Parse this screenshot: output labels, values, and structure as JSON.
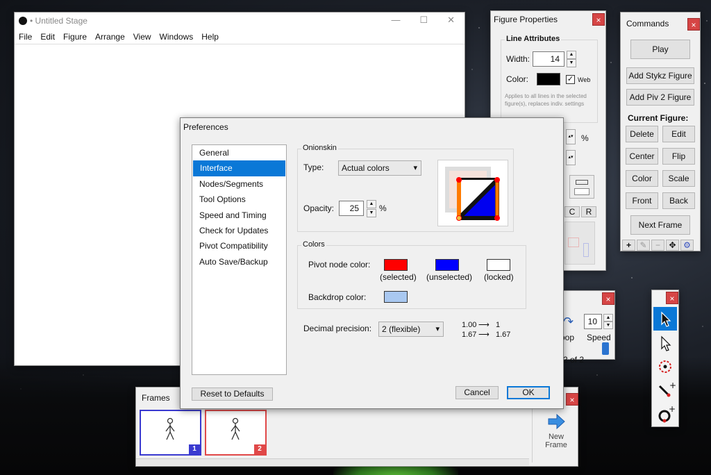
{
  "stage": {
    "title": "• Untitled Stage",
    "menu": [
      "File",
      "Edit",
      "Figure",
      "Arrange",
      "View",
      "Windows",
      "Help"
    ],
    "controls": [
      "—",
      "☐",
      "✕"
    ]
  },
  "figure_properties": {
    "title": "Figure Properties",
    "close": "×",
    "line_attributes": {
      "group_label": "Line Attributes",
      "width_label": "Width:",
      "width_value": "14",
      "color_label": "Color:",
      "color_value": "#000000",
      "web_label": "Web",
      "web_checked": true,
      "note": "Applies to all lines in the selected figure(s), replaces indiv. settings"
    },
    "percent": "%",
    "tab_c": "C",
    "tab_r": "R"
  },
  "commands": {
    "title": "Commands",
    "close": "×",
    "play": "Play",
    "add_stykz": "Add Stykz Figure",
    "add_piv2": "Add Piv 2 Figure",
    "current_figure_label": "Current Figure:",
    "buttons": [
      "Delete",
      "Edit",
      "Center",
      "Flip",
      "Color",
      "Scale",
      "Front",
      "Back"
    ],
    "next_frame": "Next Frame",
    "bottom_icons": [
      "+",
      "✎",
      "−",
      "✥",
      "⚙"
    ]
  },
  "playback": {
    "close": "×",
    "speed_value": "10",
    "loop_label": "oop",
    "speed_label": "Speed",
    "frame_counter": "2 of 2"
  },
  "toolbox": {
    "close": "×",
    "tools": [
      "select-tool",
      "direct-select-tool",
      "rotate-tool",
      "add-line-tool",
      "add-circle-tool"
    ]
  },
  "frames": {
    "title": "Frames",
    "close": "×",
    "items": [
      {
        "number": "1",
        "color": "#3a3ad0"
      },
      {
        "number": "2",
        "color": "#e04848"
      }
    ],
    "new_frame_line1": "New",
    "new_frame_line2": "Frame"
  },
  "preferences": {
    "title": "Preferences",
    "nav": [
      "General",
      "Interface",
      "Nodes/Segments",
      "Tool Options",
      "Speed and Timing",
      "Check for Updates",
      "Pivot Compatibility",
      "Auto Save/Backup"
    ],
    "selected_nav": "Interface",
    "onionskin": {
      "group_label": "Onionskin",
      "type_label": "Type:",
      "type_value": "Actual colors",
      "opacity_label": "Opacity:",
      "opacity_value": "25",
      "percent": "%"
    },
    "colors": {
      "group_label": "Colors",
      "pivot_label": "Pivot node color:",
      "backdrop_label": "Backdrop color:",
      "swatches": [
        {
          "caption": "(selected)",
          "color": "#ff0000"
        },
        {
          "caption": "(unselected)",
          "color": "#0000ff"
        },
        {
          "caption": "(locked)",
          "color": "#ffffff"
        }
      ],
      "backdrop_color": "#a9c8f0"
    },
    "decimal": {
      "label": "Decimal precision:",
      "value": "2 (flexible)",
      "example1_from": "1.00",
      "example1_to": "1",
      "example2_from": "1.67",
      "example2_to": "1.67"
    },
    "reset": "Reset to Defaults",
    "cancel": "Cancel",
    "ok": "OK"
  }
}
